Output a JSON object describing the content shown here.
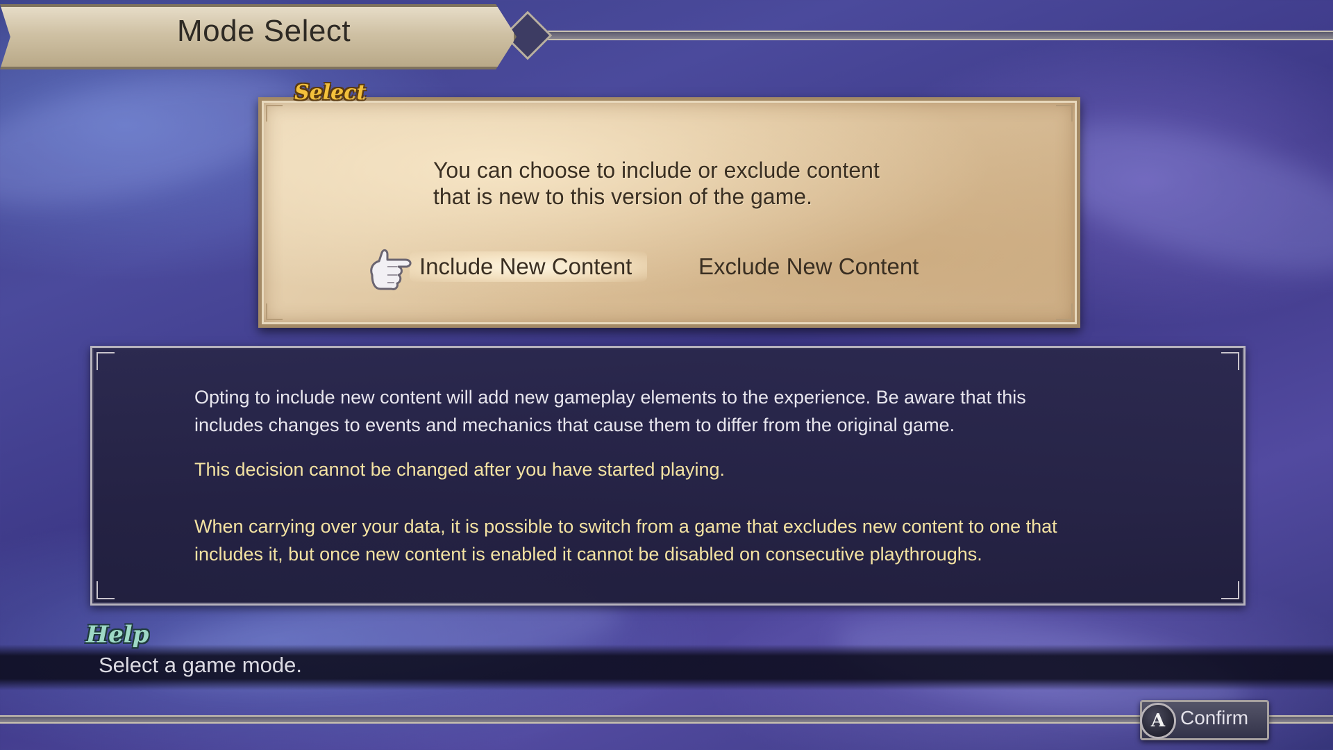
{
  "header": {
    "title": "Mode Select"
  },
  "select_panel": {
    "tag": "Select",
    "description_line1": "You can choose to include or exclude content",
    "description_line2": "that is new to this version of the game.",
    "options": [
      {
        "label": "Include New Content",
        "selected": true
      },
      {
        "label": "Exclude New Content",
        "selected": false
      }
    ],
    "cursor_icon": "pointing-hand-icon"
  },
  "info_panel": {
    "paragraph1_line1": "Opting to include new content will add new gameplay elements to the experience. Be aware that this",
    "paragraph1_line2": "includes changes to events and mechanics that cause them to differ from the original game.",
    "warning": "This decision cannot be changed after you have started playing.",
    "note_line1": "When carrying over your data, it is possible to switch from a game that excludes new content to one that",
    "note_line2": "includes it, but once new content is enabled it cannot be disabled on consecutive playthroughs."
  },
  "help": {
    "tag": "Help",
    "text": "Select a game mode."
  },
  "footer": {
    "button_glyph": "A",
    "confirm_label": "Confirm"
  },
  "colors": {
    "parchment": "#dcc19a",
    "warning_text": "#f3e2a2",
    "select_tag": "#f4c13c",
    "help_tag": "#9ed9c6"
  }
}
